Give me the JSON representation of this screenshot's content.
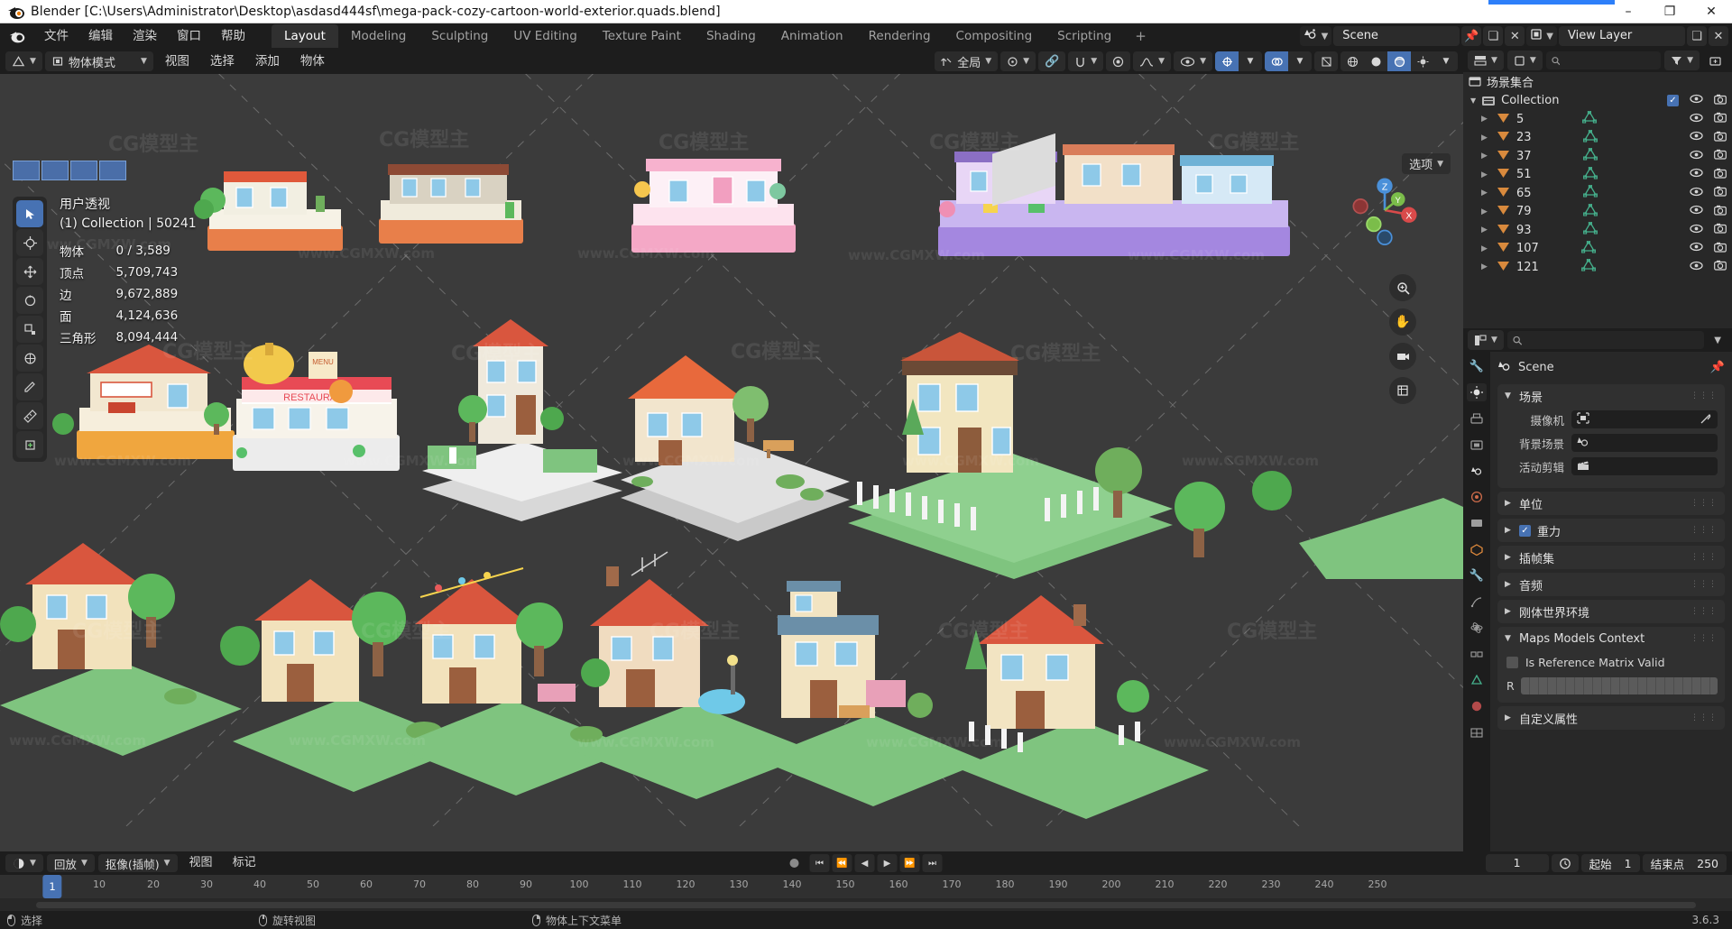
{
  "window": {
    "title": "Blender [C:\\Users\\Administrator\\Desktop\\asdasd444sf\\mega-pack-cozy-cartoon-world-exterior.quads.blend]",
    "minimize": "–",
    "maximize": "❐",
    "close": "✕"
  },
  "topbar": {
    "menus": [
      "文件",
      "编辑",
      "渲染",
      "窗口",
      "帮助"
    ],
    "workspaces": [
      {
        "label": "Layout",
        "active": true
      },
      {
        "label": "Modeling",
        "active": false
      },
      {
        "label": "Sculpting",
        "active": false
      },
      {
        "label": "UV Editing",
        "active": false
      },
      {
        "label": "Texture Paint",
        "active": false
      },
      {
        "label": "Shading",
        "active": false
      },
      {
        "label": "Animation",
        "active": false
      },
      {
        "label": "Rendering",
        "active": false
      },
      {
        "label": "Compositing",
        "active": false
      },
      {
        "label": "Scripting",
        "active": false
      }
    ],
    "add_workspace": "+",
    "scene_name": "Scene",
    "view_layer_name": "View Layer"
  },
  "viewport": {
    "mode": "物体模式",
    "menus": [
      "视图",
      "选择",
      "添加",
      "物体"
    ],
    "transform_orientation": "全局",
    "options_label": "选项",
    "stats": {
      "view_name": "用户透视",
      "collection_line": "(1) Collection | 50241",
      "rows": [
        {
          "label": "物体",
          "value": "0 / 3,589"
        },
        {
          "label": "顶点",
          "value": "5,709,743"
        },
        {
          "label": "边",
          "value": "9,672,889"
        },
        {
          "label": "面",
          "value": "4,124,636"
        },
        {
          "label": "三角形",
          "value": "8,094,444"
        }
      ]
    },
    "gizmo_axes": [
      "Z",
      "Y",
      "X"
    ]
  },
  "outliner": {
    "search_placeholder": "",
    "scene_collection": "场景集合",
    "collection": "Collection",
    "items": [
      {
        "name": "5"
      },
      {
        "name": "23"
      },
      {
        "name": "37"
      },
      {
        "name": "51"
      },
      {
        "name": "65"
      },
      {
        "name": "79"
      },
      {
        "name": "93"
      },
      {
        "name": "107"
      },
      {
        "name": "121"
      }
    ]
  },
  "properties": {
    "breadcrumb": "Scene",
    "panels": [
      {
        "title": "场景",
        "open": true,
        "fields": [
          {
            "label": "摄像机",
            "value": ""
          },
          {
            "label": "背景场景",
            "value": ""
          },
          {
            "label": "活动剪辑",
            "value": ""
          }
        ]
      },
      {
        "title": "单位",
        "open": false,
        "fields": []
      },
      {
        "title": "重力",
        "open": false,
        "checkbox": true,
        "fields": []
      },
      {
        "title": "插帧集",
        "open": false,
        "fields": []
      },
      {
        "title": "音频",
        "open": false,
        "fields": []
      },
      {
        "title": "刚体世界环境",
        "open": false,
        "fields": []
      },
      {
        "title": "Maps Models Context",
        "open": true,
        "fields": []
      },
      {
        "title": "自定义属性",
        "open": false,
        "fields": []
      }
    ],
    "maps_checkbox_label": "Is Reference Matrix Valid",
    "maps_r_label": "R"
  },
  "timeline": {
    "playback": "回放",
    "keying": "抠像(插帧)",
    "view": "视图",
    "marker": "标记",
    "current_frame": "1",
    "start_label": "起始",
    "start_value": "1",
    "end_label": "结束点",
    "end_value": "250",
    "ticks": [
      "1",
      "10",
      "20",
      "30",
      "40",
      "50",
      "60",
      "70",
      "80",
      "90",
      "100",
      "110",
      "120",
      "130",
      "140",
      "150",
      "160",
      "170",
      "180",
      "190",
      "200",
      "210",
      "220",
      "230",
      "240",
      "250"
    ]
  },
  "statusbar": {
    "select": "选择",
    "rotate_view": "旋转视图",
    "context_menu": "物体上下文菜单",
    "version": "3.6.3"
  },
  "watermarks": {
    "site": "www.CGMXW.com",
    "brand": "CG模型主"
  },
  "colors": {
    "accent": "#4772b3",
    "orange": "#d98a3d",
    "mesh_green": "#45b08c",
    "viewport_bg": "#3b3b3b",
    "panel_bg": "#303030",
    "editor_bg": "#282828",
    "header_bg": "#1d1d1d"
  }
}
